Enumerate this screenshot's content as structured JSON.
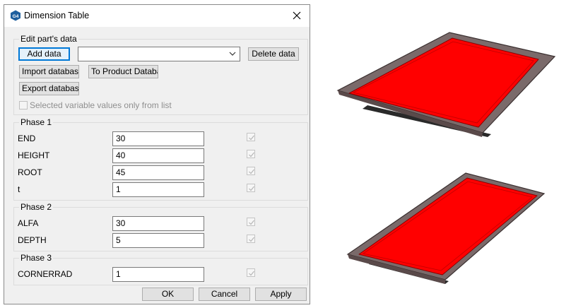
{
  "dialog": {
    "title": "Dimension Table",
    "app_icon_text": "G4"
  },
  "edit_group": {
    "legend": "Edit part's data",
    "add_data_label": "Add data",
    "combo_value": "",
    "delete_data_label": "Delete data",
    "import_label": "Import database",
    "to_product_label": "To Product Database",
    "export_label": "Export database",
    "selected_only_label": "Selected variable values only from list"
  },
  "phases": [
    {
      "legend": "Phase  1",
      "rows": [
        {
          "label": "END",
          "value": "30"
        },
        {
          "label": "HEIGHT",
          "value": "40"
        },
        {
          "label": "ROOT",
          "value": "45"
        },
        {
          "label": "t",
          "value": "1"
        }
      ]
    },
    {
      "legend": "Phase  2",
      "rows": [
        {
          "label": "ALFA",
          "value": "30"
        },
        {
          "label": "DEPTH",
          "value": "5"
        }
      ]
    },
    {
      "legend": "Phase  3",
      "rows": [
        {
          "label": "CORNERRAD",
          "value": "1"
        }
      ]
    }
  ],
  "footer": {
    "ok_label": "OK",
    "cancel_label": "Cancel",
    "apply_label": "Apply"
  },
  "colors": {
    "accent": "#0078d7",
    "tray_fill": "#ff0000",
    "tray_frame": "#7a6a6a"
  },
  "icons": {
    "app": "g4-hex-icon",
    "close": "close-icon",
    "combo": "chevron-down-icon",
    "check": "check-icon"
  }
}
